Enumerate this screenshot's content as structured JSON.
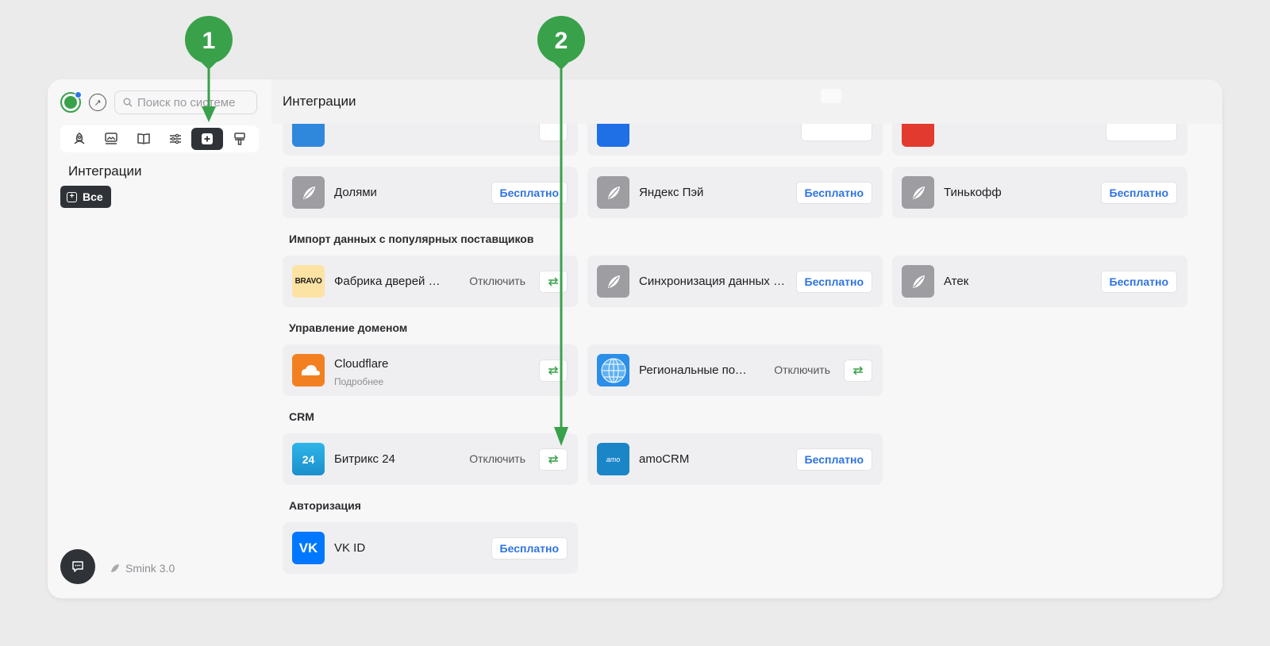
{
  "sidebar": {
    "search_placeholder": "Поиск по системе",
    "title": "Интеграции",
    "filter_all": "Все",
    "brand": "Smink 3.0"
  },
  "main": {
    "title": "Интеграции",
    "sections": {
      "payments": "",
      "import": "Импорт данных с популярных поставщиков",
      "domain": "Управление доменом",
      "crm": "CRM",
      "auth": "Авторизация"
    },
    "cards": {
      "dolyami": "Долями",
      "yandex_pay": "Яндекс Пэй",
      "tinkoff": "Тинькофф",
      "bravo": "Фабрика дверей — BRAVO",
      "sync": "Синхронизация данных товаров",
      "atek": "Атек",
      "cloudflare": "Cloudflare",
      "cloudflare_sub": "Подробнее",
      "regional": "Региональные поддомены",
      "bitrix": "Битрикс 24",
      "amocrm": "amoCRM",
      "vkid": "VK ID"
    },
    "labels": {
      "free": "Бесплатно",
      "disable": "Отключить"
    }
  },
  "markers": {
    "one": "1",
    "two": "2"
  },
  "colors": {
    "accent_green": "#3aa14b",
    "link_blue": "#2f73e0",
    "dark": "#2f3237"
  }
}
